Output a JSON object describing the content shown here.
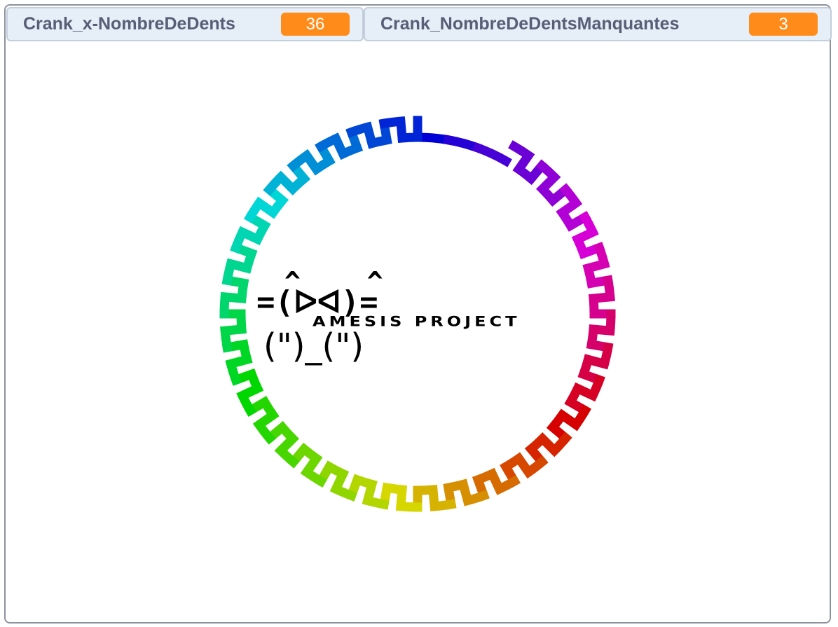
{
  "monitors": [
    {
      "label": "Crank_x-NombreDeDents",
      "value": "36"
    },
    {
      "label": "Crank_NombreDeDentsManquantes",
      "value": "3"
    }
  ],
  "stage": {
    "gear": {
      "teeth": 36,
      "missing_teeth": 3
    },
    "logo": {
      "ears": "^ ^",
      "face": "=(ᐅᐊ)=",
      "paws": "(\")_(\")",
      "title": "AMESIS PROJECT"
    }
  }
}
